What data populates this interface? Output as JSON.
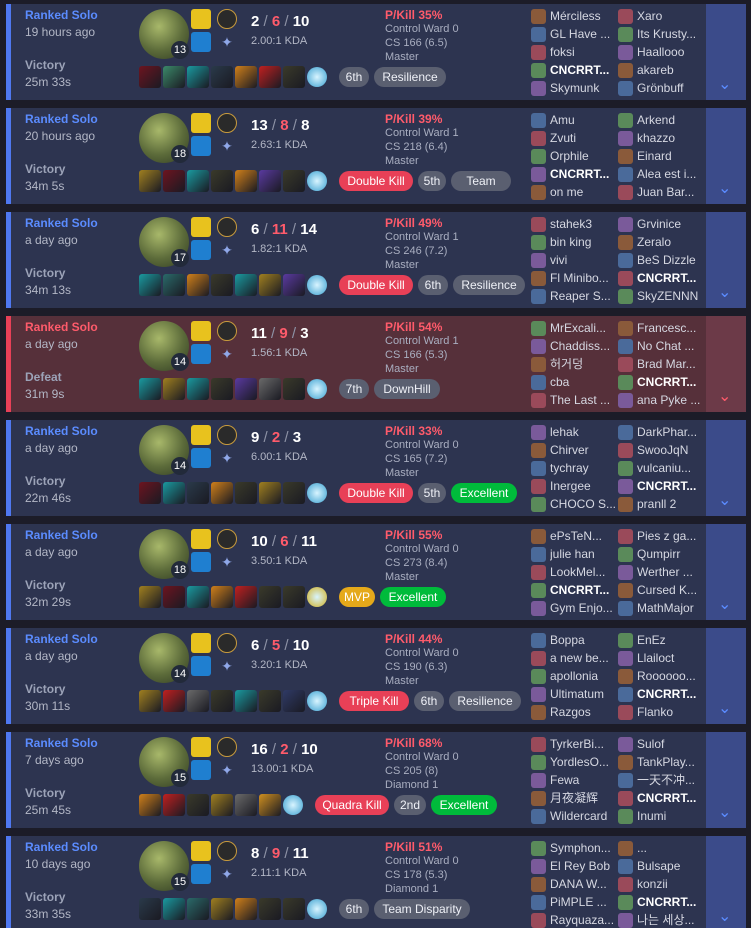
{
  "colors": {
    "win_accent": "#4f78f0",
    "loss_accent": "#e84057",
    "win_bg": "#2d3450",
    "loss_bg": "#56303a",
    "badge_red": "#e84057",
    "badge_green": "#00bb3b",
    "badge_gold": "#e5a91a"
  },
  "matches": [
    {
      "queue": "Ranked Solo",
      "ago": "19 hours ago",
      "result": "Victory",
      "duration": "25m 33s",
      "win": true,
      "level": "13",
      "kills": "2",
      "deaths": "6",
      "assists": "10",
      "kda_ratio": "2.00:1 KDA",
      "pkill": "P/Kill 35%",
      "control_ward": "Control Ward 0",
      "cs": "CS 166 (6.5)",
      "rank": "Master",
      "item_colors": [
        "#6d1420",
        "#3b8a6a",
        "#1a9aa0",
        "#2a3a4a",
        "#d0801a",
        "#c02020",
        "#3a3a2a",
        "#3aa0d0"
      ],
      "badges": [
        {
          "label": "6th",
          "style": "gray"
        },
        {
          "label": "Resilience",
          "style": "gray"
        }
      ],
      "team1": [
        "Mérciless",
        "GL Have ...",
        "foksi",
        "CNCRRT...",
        "Skymunk"
      ],
      "team2": [
        "Xaro",
        "Its Krusty...",
        "Haallooo",
        "akareb",
        "Grönbuff"
      ],
      "me_team": 1,
      "me_idx": 3
    },
    {
      "queue": "Ranked Solo",
      "ago": "20 hours ago",
      "result": "Victory",
      "duration": "34m 5s",
      "win": true,
      "level": "18",
      "kills": "13",
      "deaths": "8",
      "assists": "8",
      "kda_ratio": "2.63:1 KDA",
      "pkill": "P/Kill 39%",
      "control_ward": "Control Ward 1",
      "cs": "CS 218 (6.4)",
      "rank": "Master",
      "item_colors": [
        "#a08020",
        "#6d1420",
        "#1a9aa0",
        "#3a3a2a",
        "#d0801a",
        "#5a3aa0",
        "#3a3a2a",
        "#3aa0d0"
      ],
      "badges": [
        {
          "label": "Double Kill",
          "style": "red"
        },
        {
          "label": "5th",
          "style": "gray"
        },
        {
          "label": "Team",
          "style": "gray"
        }
      ],
      "team1": [
        "Amu",
        "Zvuti",
        "Orphile",
        "CNCRRT...",
        "on me"
      ],
      "team2": [
        "Arkend",
        "khazzo",
        "Einard",
        "Alea est i...",
        "Juan Bar..."
      ],
      "me_team": 1,
      "me_idx": 3
    },
    {
      "queue": "Ranked Solo",
      "ago": "a day ago",
      "result": "Victory",
      "duration": "34m 13s",
      "win": true,
      "level": "17",
      "kills": "6",
      "deaths": "11",
      "assists": "14",
      "kda_ratio": "1.82:1 KDA",
      "pkill": "P/Kill 49%",
      "control_ward": "Control Ward 1",
      "cs": "CS 246 (7.2)",
      "rank": "Master",
      "item_colors": [
        "#1a9aa0",
        "#2a6a6a",
        "#d0801a",
        "#3a3a2a",
        "#1a9aa0",
        "#a08020",
        "#5a3aa0",
        "#3aa0d0"
      ],
      "badges": [
        {
          "label": "Double Kill",
          "style": "red"
        },
        {
          "label": "6th",
          "style": "gray"
        },
        {
          "label": "Resilience",
          "style": "gray"
        }
      ],
      "team1": [
        "stahek3",
        "bin king",
        "vivi",
        "Fl Minibo...",
        "Reaper S..."
      ],
      "team2": [
        "Grvinice",
        "Zeralo",
        "BeS Dizzle",
        "CNCRRT...",
        "SkyZENNN"
      ],
      "me_team": 2,
      "me_idx": 3
    },
    {
      "queue": "Ranked Solo",
      "ago": "a day ago",
      "result": "Defeat",
      "duration": "31m 9s",
      "win": false,
      "level": "14",
      "kills": "11",
      "deaths": "9",
      "assists": "3",
      "kda_ratio": "1.56:1 KDA",
      "pkill": "P/Kill 54%",
      "control_ward": "Control Ward 1",
      "cs": "CS 166 (5.3)",
      "rank": "Master",
      "item_colors": [
        "#1a9aa0",
        "#a08020",
        "#1a9aa0",
        "#3a3a2a",
        "#5a3aa0",
        "#6a6a6a",
        "#3a3a2a",
        "#3aa0d0"
      ],
      "badges": [
        {
          "label": "7th",
          "style": "gray"
        },
        {
          "label": "DownHill",
          "style": "gray"
        }
      ],
      "team1": [
        "MrExcali...",
        "Chaddiss...",
        "허거덩",
        "cba",
        "The Last ..."
      ],
      "team2": [
        "Francesc...",
        "No Chat ...",
        "Brad Mar...",
        "CNCRRT...",
        "ana Pyke ..."
      ],
      "me_team": 2,
      "me_idx": 3
    },
    {
      "queue": "Ranked Solo",
      "ago": "a day ago",
      "result": "Victory",
      "duration": "22m 46s",
      "win": true,
      "level": "14",
      "kills": "9",
      "deaths": "2",
      "assists": "3",
      "kda_ratio": "6.00:1 KDA",
      "pkill": "P/Kill 33%",
      "control_ward": "Control Ward 0",
      "cs": "CS 165 (7.2)",
      "rank": "Master",
      "item_colors": [
        "#6d1420",
        "#1a9aa0",
        "#2a3a4a",
        "#d0801a",
        "#3a3a2a",
        "#a08020",
        "#3a3a2a",
        "#3aa0d0"
      ],
      "badges": [
        {
          "label": "Double Kill",
          "style": "red"
        },
        {
          "label": "5th",
          "style": "gray"
        },
        {
          "label": "Excellent",
          "style": "green"
        }
      ],
      "team1": [
        "lehak",
        "Chirver",
        "tychray",
        "Inergee",
        "CHOCO S..."
      ],
      "team2": [
        "DarkPhar...",
        "SwooJqN",
        "vulcaniu...",
        "CNCRRT...",
        "pranll 2"
      ],
      "me_team": 2,
      "me_idx": 3
    },
    {
      "queue": "Ranked Solo",
      "ago": "a day ago",
      "result": "Victory",
      "duration": "32m 29s",
      "win": true,
      "level": "18",
      "kills": "10",
      "deaths": "6",
      "assists": "11",
      "kda_ratio": "3.50:1 KDA",
      "pkill": "P/Kill 55%",
      "control_ward": "Control Ward 0",
      "cs": "CS 273 (8.4)",
      "rank": "Master",
      "item_colors": [
        "#a08020",
        "#6d1420",
        "#1a9aa0",
        "#d0801a",
        "#c02020",
        "#3a3a2a",
        "#3a3a2a",
        "#d0b020"
      ],
      "badges": [
        {
          "label": "MVP",
          "style": "gold"
        },
        {
          "label": "Excellent",
          "style": "green"
        }
      ],
      "team1": [
        "ePsTeN...",
        "julie han",
        "LookMel...",
        "CNCRRT...",
        "Gym Enjo..."
      ],
      "team2": [
        "Pies z ga...",
        "Qumpirr",
        "Werther ...",
        "Cursed K...",
        "MathMajor"
      ],
      "me_team": 1,
      "me_idx": 3
    },
    {
      "queue": "Ranked Solo",
      "ago": "a day ago",
      "result": "Victory",
      "duration": "30m 11s",
      "win": true,
      "level": "14",
      "kills": "6",
      "deaths": "5",
      "assists": "10",
      "kda_ratio": "3.20:1 KDA",
      "pkill": "P/Kill 44%",
      "control_ward": "Control Ward 0",
      "cs": "CS 190 (6.3)",
      "rank": "Master",
      "item_colors": [
        "#a08020",
        "#c02020",
        "#6a6a6a",
        "#3a3a2a",
        "#1a9aa0",
        "#3a3a2a",
        "#2f3a66",
        "#3aa0d0"
      ],
      "badges": [
        {
          "label": "Triple Kill",
          "style": "red"
        },
        {
          "label": "6th",
          "style": "gray"
        },
        {
          "label": "Resilience",
          "style": "gray"
        }
      ],
      "team1": [
        "Boppa",
        "a new be...",
        "apollonia",
        "Ultimatum",
        "Razgos"
      ],
      "team2": [
        "EnEz",
        "Llailoct",
        "Roooooo...",
        "CNCRRT...",
        "Flanko"
      ],
      "me_team": 2,
      "me_idx": 3
    },
    {
      "queue": "Ranked Solo",
      "ago": "7 days ago",
      "result": "Victory",
      "duration": "25m 45s",
      "win": true,
      "level": "15",
      "kills": "16",
      "deaths": "2",
      "assists": "10",
      "kda_ratio": "13.00:1 KDA",
      "pkill": "P/Kill 68%",
      "control_ward": "Control Ward 0",
      "cs": "CS 205 (8)",
      "rank": "Diamond 1",
      "item_colors": [
        "#d0801a",
        "#c02020",
        "#3a3a2a",
        "#a08020",
        "#6a6a6a",
        "#d09020",
        "#3aa0d0"
      ],
      "badges": [
        {
          "label": "Quadra Kill",
          "style": "red"
        },
        {
          "label": "2nd",
          "style": "gray"
        },
        {
          "label": "Excellent",
          "style": "green"
        }
      ],
      "team1": [
        "TyrkerBi...",
        "YordlesO...",
        "Fewa",
        "月夜凝辉",
        "Wildercard"
      ],
      "team2": [
        "Sulof",
        "TankPlay...",
        "一天不冲...",
        "CNCRRT...",
        "Inumi"
      ],
      "me_team": 2,
      "me_idx": 3
    },
    {
      "queue": "Ranked Solo",
      "ago": "10 days ago",
      "result": "Victory",
      "duration": "33m 35s",
      "win": true,
      "level": "15",
      "kills": "8",
      "deaths": "9",
      "assists": "11",
      "kda_ratio": "2.11:1 KDA",
      "pkill": "P/Kill 51%",
      "control_ward": "Control Ward 0",
      "cs": "CS 178 (5.3)",
      "rank": "Diamond 1",
      "item_colors": [
        "#2a3a4a",
        "#1a9aa0",
        "#2a6a6a",
        "#a08020",
        "#d0801a",
        "#3a3a2a",
        "#3a3a2a",
        "#3aa0d0"
      ],
      "badges": [
        {
          "label": "6th",
          "style": "gray"
        },
        {
          "label": "Team Disparity",
          "style": "gray"
        }
      ],
      "team1": [
        "Symphon...",
        "El Rey Bob",
        "DANA W...",
        "PiMPLE ...",
        "Rayquaza..."
      ],
      "team2": [
        "...",
        "Bulsape",
        "konzii",
        "CNCRRT...",
        "나는 세상..."
      ],
      "me_team": 2,
      "me_idx": 3
    }
  ]
}
